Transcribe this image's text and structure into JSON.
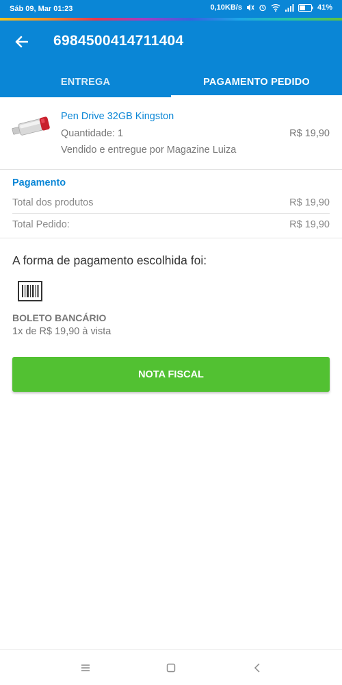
{
  "status_bar": {
    "time": "Sáb 09, Mar 01:23",
    "network_speed": "0,10KB/s",
    "battery": "41%"
  },
  "header": {
    "order_number": "6984500414711404",
    "tabs": [
      {
        "label": "ENTREGA",
        "active": false
      },
      {
        "label": "PAGAMENTO PEDIDO",
        "active": true
      }
    ]
  },
  "product": {
    "name": "Pen Drive 32GB Kingston",
    "quantity": "Quantidade: 1",
    "price": "R$ 19,90",
    "seller": "Vendido e entregue por Magazine Luiza",
    "image_icon": "usb-drive-icon"
  },
  "payment": {
    "title": "Pagamento",
    "rows": [
      {
        "label": "Total dos produtos",
        "value": "R$ 19,90"
      },
      {
        "label": "Total Pedido:",
        "value": "R$ 19,90"
      }
    ]
  },
  "method": {
    "heading": "A forma de pagamento escolhida foi:",
    "icon": "barcode-icon",
    "name": "BOLETO BANCÁRIO",
    "installment": "1x de R$ 19,90 à vista"
  },
  "actions": {
    "nota_fiscal_label": "NOTA FISCAL"
  },
  "colors": {
    "primary": "#0a86d6",
    "button_green": "#52c132"
  }
}
